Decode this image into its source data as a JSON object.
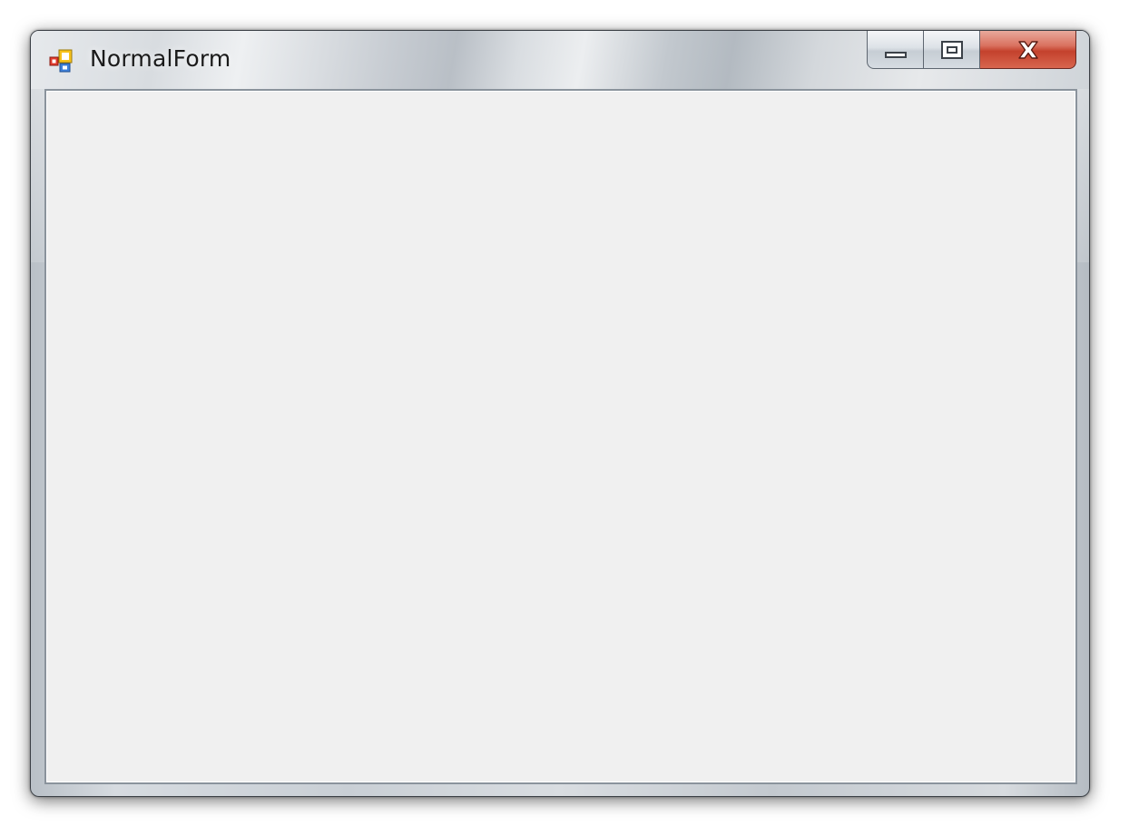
{
  "window": {
    "title": "NormalForm",
    "icon": "windows-forms-app-icon"
  },
  "caption_buttons": {
    "minimize_icon": "minimize-icon",
    "maximize_icon": "maximize-icon",
    "close_icon": "close-icon"
  },
  "colors": {
    "client_background": "#f0f0f0",
    "close_button": "#c4412c",
    "frame": "#c9cfd5"
  }
}
